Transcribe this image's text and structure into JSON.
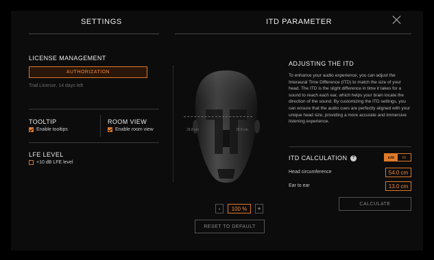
{
  "settings": {
    "title": "SETTINGS",
    "license": {
      "title": "LICENSE MANAGEMENT",
      "auth_button": "AUTHORIZATION",
      "trial_text": "Trial License, 14 days left"
    },
    "tooltip": {
      "title": "TOOLTIP",
      "checkbox_label": "Enable tooltips",
      "checked": true
    },
    "room_view": {
      "title": "ROOM VIEW",
      "checkbox_label": "Enable room view",
      "checked": true
    },
    "lfe": {
      "title": "LFE LEVEL",
      "checkbox_label": "+10 dB LFE level",
      "checked": false
    }
  },
  "itd": {
    "title": "ITD PARAMETER",
    "close_icon": "close-icon",
    "measure_left_label": "28.8 cm",
    "measure_right_label": "28.8 cm",
    "zoom": {
      "minus": "-",
      "value": "100 %",
      "plus": "+"
    },
    "reset_button": "RESET TO DEFAULT",
    "adjusting": {
      "title": "ADJUSTING THE ITD",
      "body": "To enhance your audio experience, you can adjust the Interaural Time Difference (ITD) to match the size of your head. The ITD is the slight difference in time it takes for a sound to reach each ear, which helps your brain locate the direction of the sound. By customizing the ITD settings, you can ensure that the audio cues are perfectly aligned with your unique head size, providing a more accurate and immersive listening experience."
    },
    "calculation": {
      "title": "ITD CALCULATION",
      "help_icon": "?",
      "units": {
        "cm": "cm",
        "in": "in",
        "selected": "cm"
      },
      "head_circumference_label": "Head circumference",
      "head_circumference_value": "54.0 cm",
      "ear_to_ear_label": "Ear to ear",
      "ear_to_ear_value": "13.0 cm",
      "calculate_button": "CALCULATE"
    }
  },
  "colors": {
    "accent": "#e07a2a",
    "background": "#0c0c0c",
    "text": "#e8e8e8"
  }
}
